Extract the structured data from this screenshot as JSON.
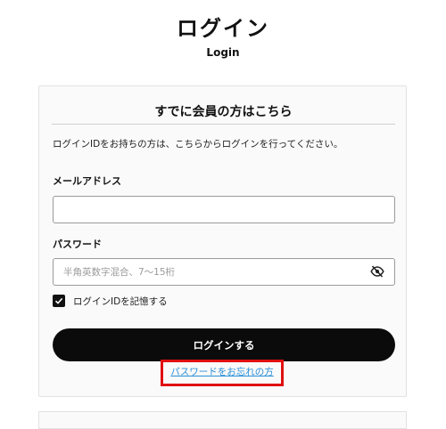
{
  "header": {
    "title": "ログイン",
    "subtitle": "Login"
  },
  "login_card": {
    "heading": "すでに会員の方はこちら",
    "intro": "ログインIDをお持ちの方は、こちらからログインを行ってください。",
    "email": {
      "label": "メールアドレス",
      "value": "",
      "placeholder": ""
    },
    "password": {
      "label": "パスワード",
      "value": "",
      "placeholder": "半角英数字混合、7～15桁",
      "visibility_icon": "eye-slash-icon"
    },
    "remember": {
      "label": "ログインIDを記憶する",
      "checked": true,
      "icon": "checkmark-icon"
    },
    "submit_label": "ログインする",
    "forgot_link": "パスワードをお忘れの方",
    "highlight_color": "#e01010",
    "link_color": "#2a8fd8",
    "button_color": "#0b0b0b"
  }
}
